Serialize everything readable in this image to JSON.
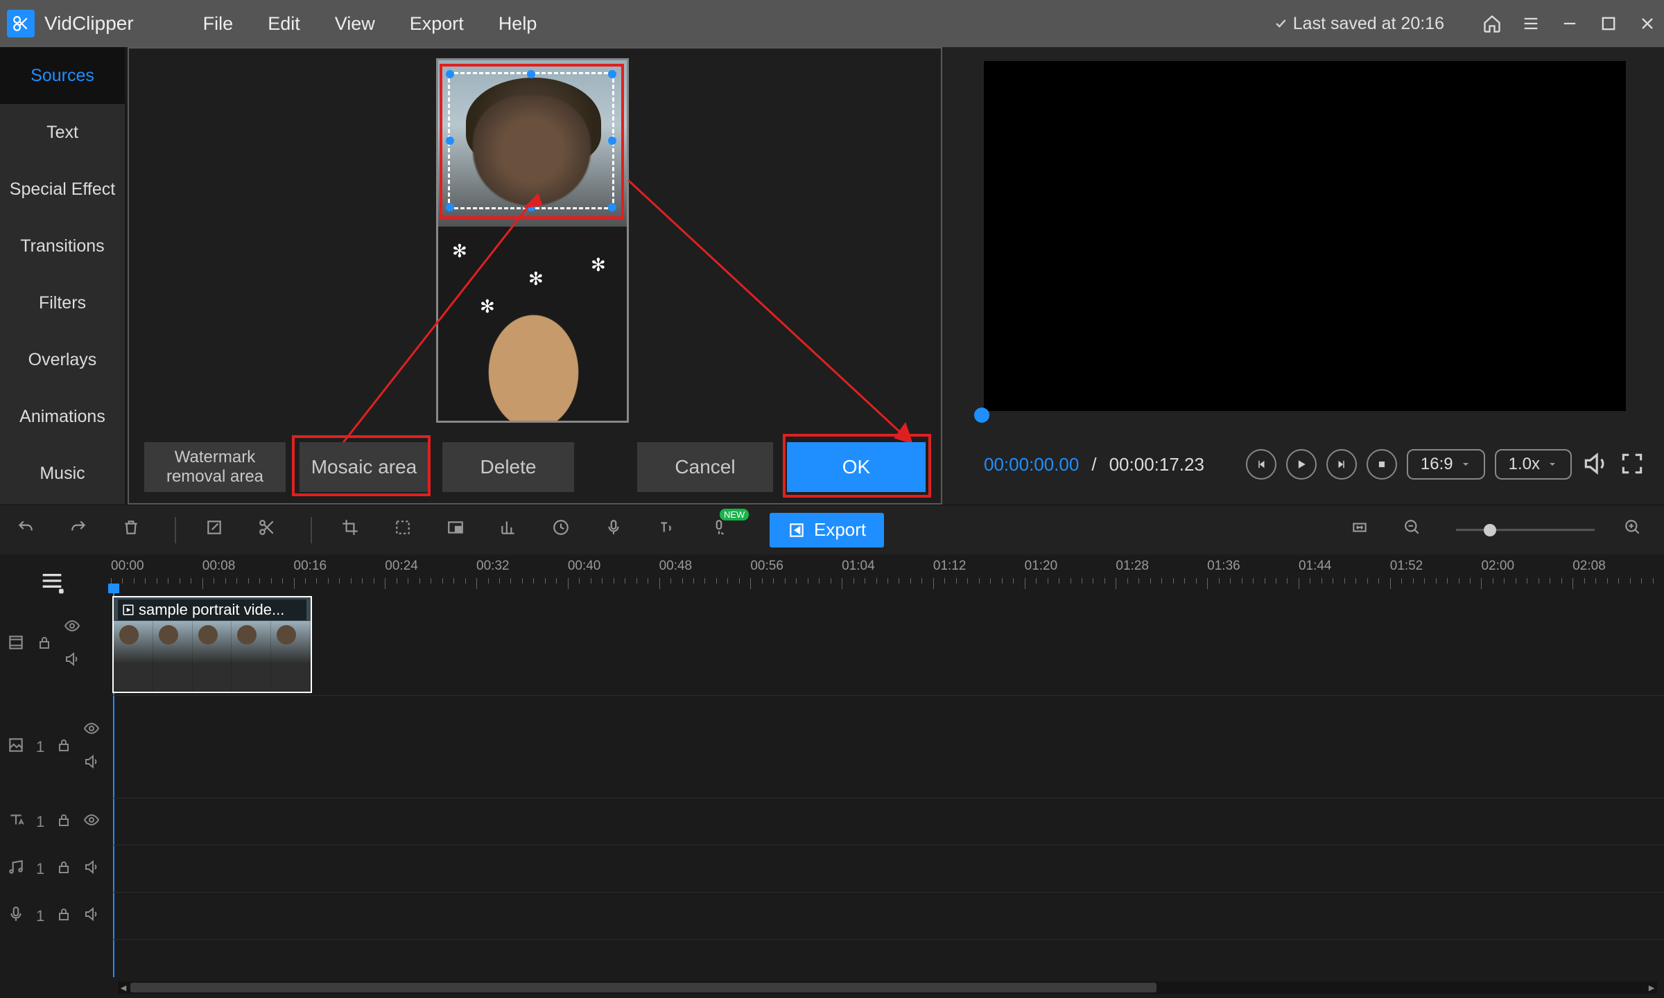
{
  "app": {
    "name": "VidClipper",
    "last_saved": "Last saved at 20:16"
  },
  "menu": {
    "file": "File",
    "edit": "Edit",
    "view": "View",
    "export": "Export",
    "help": "Help"
  },
  "sidebar": {
    "items": [
      {
        "label": "Sources"
      },
      {
        "label": "Text"
      },
      {
        "label": "Special Effect"
      },
      {
        "label": "Transitions"
      },
      {
        "label": "Filters"
      },
      {
        "label": "Overlays"
      },
      {
        "label": "Animations"
      },
      {
        "label": "Music"
      }
    ]
  },
  "dialog": {
    "watermark": "Watermark removal area",
    "mosaic": "Mosaic area",
    "delete": "Delete",
    "cancel": "Cancel",
    "ok": "OK"
  },
  "preview": {
    "tc_current": "00:00:00.00",
    "tc_duration": "00:00:17.23",
    "aspect": "16:9",
    "speed": "1.0x"
  },
  "toolbar": {
    "export": "Export",
    "new_badge": "NEW"
  },
  "timeline": {
    "ticks": [
      "00:00",
      "00:08",
      "00:16",
      "00:24",
      "00:32",
      "00:40",
      "00:48",
      "00:56",
      "01:04",
      "01:12",
      "01:20",
      "01:28",
      "01:36",
      "01:44",
      "01:52",
      "02:00",
      "02:08"
    ],
    "clip_name": "sample portrait vide...",
    "track_counts": {
      "image": "1",
      "text": "1",
      "music": "1",
      "voice": "1"
    }
  }
}
